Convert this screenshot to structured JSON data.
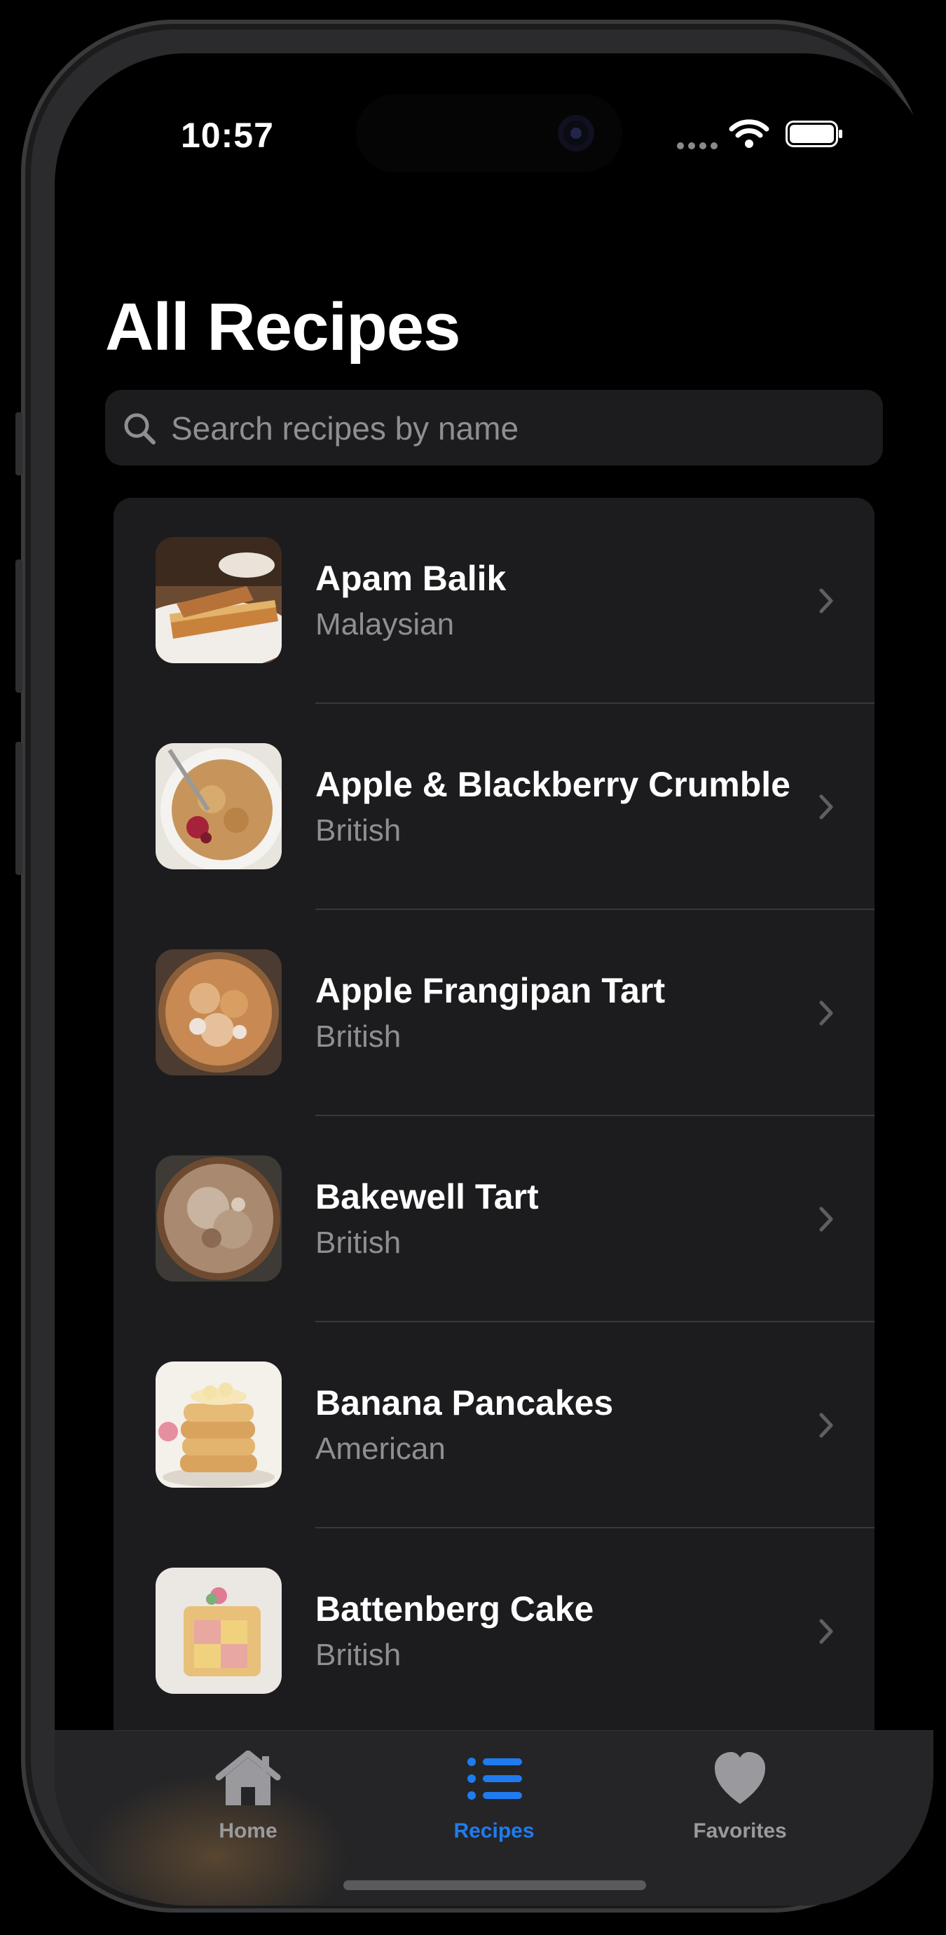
{
  "status_bar": {
    "time": "10:57"
  },
  "page": {
    "title": "All Recipes"
  },
  "search": {
    "placeholder": "Search recipes by name"
  },
  "recipes": [
    {
      "name": "Apam Balik",
      "cuisine": "Malaysian"
    },
    {
      "name": "Apple & Blackberry Crumble",
      "cuisine": "British"
    },
    {
      "name": "Apple Frangipan Tart",
      "cuisine": "British"
    },
    {
      "name": "Bakewell Tart",
      "cuisine": "British"
    },
    {
      "name": "Banana Pancakes",
      "cuisine": "American"
    },
    {
      "name": "Battenberg Cake",
      "cuisine": "British"
    }
  ],
  "tabbar": {
    "tabs": [
      {
        "label": "Home",
        "icon": "house-icon"
      },
      {
        "label": "Recipes",
        "icon": "list-icon",
        "selected": true
      },
      {
        "label": "Favorites",
        "icon": "heart-icon"
      }
    ],
    "active_color": "#1f7cf0",
    "inactive_color": "#9a9a9e"
  }
}
